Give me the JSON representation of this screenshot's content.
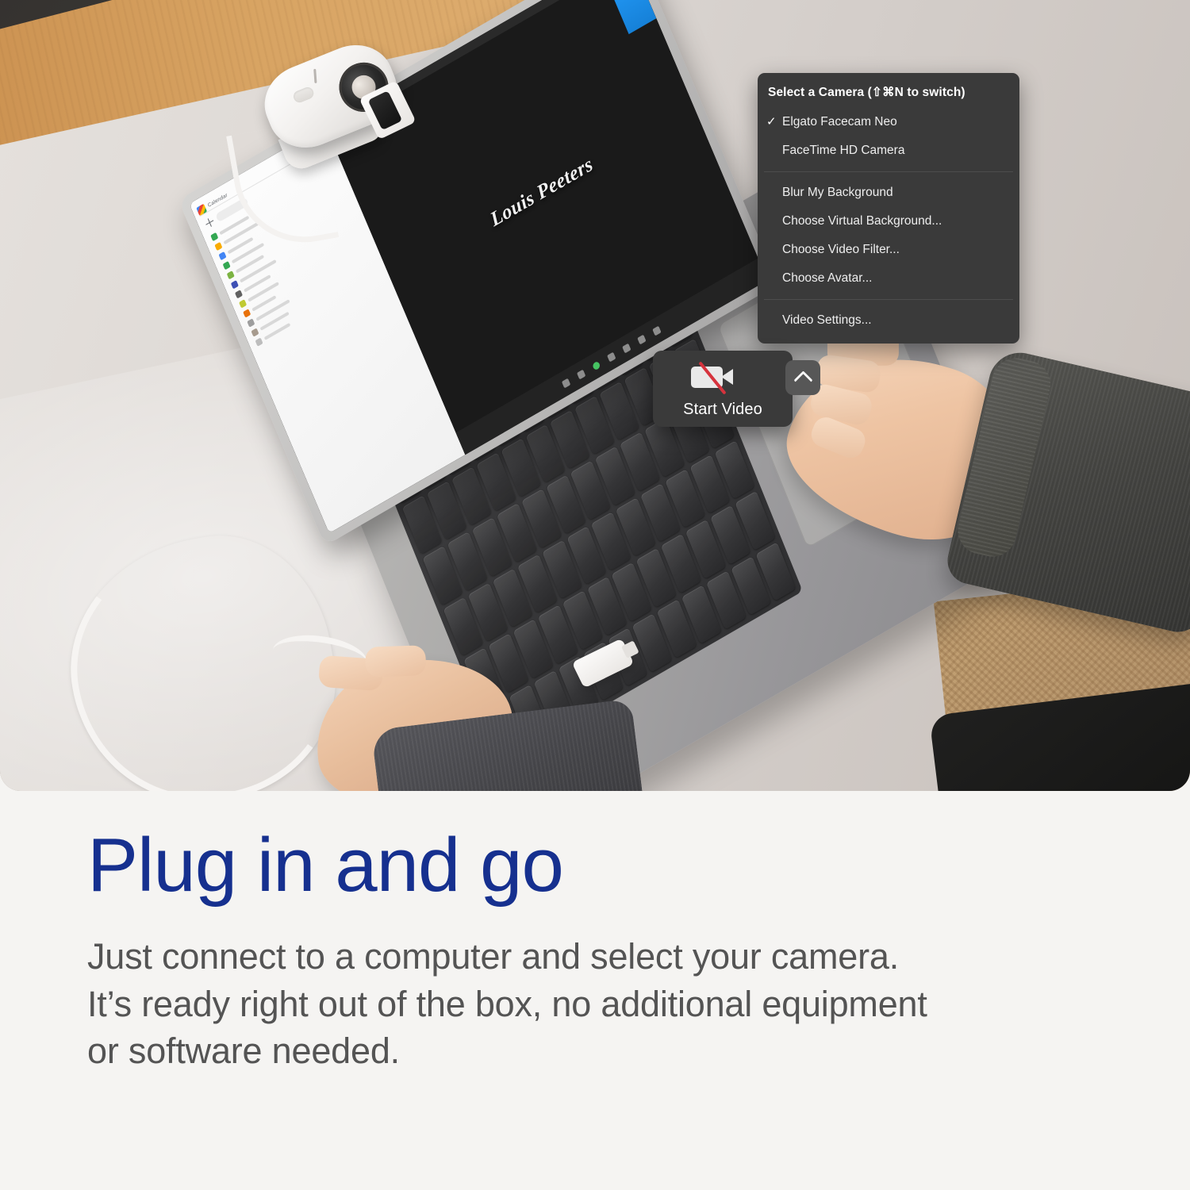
{
  "photo": {
    "alt_description": "Elgato Facecam Neo webcam clipped to a MacBook lid on a wooden desk, a person plugging in a USB-C cable with one hand while the other rests on the laptop",
    "laptop_screen": {
      "calendar_app": {
        "name": "Calendar",
        "create_label": "Create",
        "items": [
          {
            "color": "#34a853"
          },
          {
            "color": "#f9ab00"
          },
          {
            "color": "#4285f4"
          },
          {
            "color": "#34a853"
          },
          {
            "color": "#7cb342"
          },
          {
            "color": "#3f51b5"
          },
          {
            "color": "#616161"
          },
          {
            "color": "#c0ca33"
          },
          {
            "color": "#e8710a"
          },
          {
            "color": "#9e9e9e"
          },
          {
            "color": "#a79b8e"
          },
          {
            "color": "#bdbdbd"
          }
        ]
      },
      "meeting": {
        "participant_name": "Louis Peeters"
      }
    }
  },
  "camera_menu": {
    "title": "Select a Camera (⇧⌘N to switch)",
    "cameras": [
      {
        "label": "Elgato Facecam Neo",
        "selected": true,
        "check": "✓"
      },
      {
        "label": "FaceTime HD Camera",
        "selected": false,
        "check": ""
      }
    ],
    "options": [
      {
        "label": "Blur My Background"
      },
      {
        "label": "Choose Virtual Background..."
      },
      {
        "label": "Choose Video Filter..."
      },
      {
        "label": "Choose Avatar..."
      }
    ],
    "settings": [
      {
        "label": "Video Settings..."
      }
    ],
    "background_color": "#3a3a3a"
  },
  "video_control": {
    "label": "Start Video",
    "icon": "camera-off-icon",
    "slash_color": "#d6333d",
    "chevron": "chevron-up-icon",
    "background_color": "#3a3a3a"
  },
  "marketing": {
    "headline": "Plug in and go",
    "headline_color": "#16308f",
    "body_line_1": "Just connect to a computer and select your camera.",
    "body_line_2": "It’s ready right out of the box, no additional equipment",
    "body_line_3": "or software needed.",
    "body_color": "#545454",
    "page_background": "#f5f4f2"
  }
}
